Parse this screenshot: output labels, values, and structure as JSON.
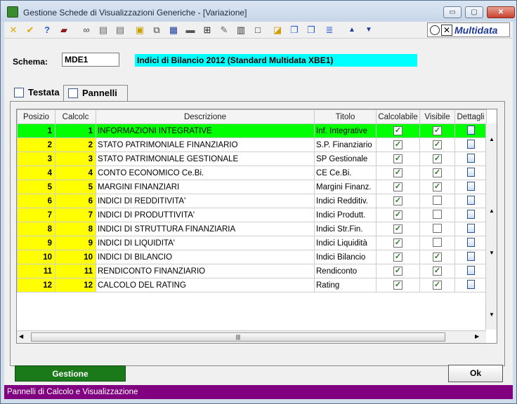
{
  "window": {
    "title": "Gestione Schede di Visualizzazioni Generiche - [Variazione]",
    "min": "▭",
    "max": "▢",
    "close": "✕"
  },
  "toolbar": {
    "icons": [
      "cancel-icon",
      "confirm-icon",
      "help-icon",
      "book-icon",
      "binoculars-icon",
      "doc-icon",
      "doc-icon",
      "tag-icon",
      "copy-icon",
      "print-icon",
      "screen-icon",
      "grid-icon",
      "edit-icon",
      "preview-icon",
      "page-icon",
      "chart-icon",
      "window-icon",
      "panel-icon",
      "form-icon",
      "arrow-up-icon",
      "arrow-down-icon"
    ],
    "brand": "Multidata"
  },
  "form": {
    "schema_label": "Schema:",
    "schema_code": "MDE1",
    "schema_desc": "Indici di Bilancio 2012 (Standard Multidata XBE1)"
  },
  "tabs": [
    {
      "label": "Testata"
    },
    {
      "label": "Pannelli"
    }
  ],
  "grid": {
    "columns": [
      "Posizio",
      "Calcolc",
      "Descrizione",
      "Titolo",
      "Calcolabile",
      "Visibile",
      "Dettagli"
    ],
    "rows": [
      {
        "pos": "1",
        "calc": "1",
        "desc": "INFORMAZIONI INTEGRATIVE",
        "title": "Inf. Integrative",
        "calcolabile": true,
        "visibile": true,
        "selected": true
      },
      {
        "pos": "2",
        "calc": "2",
        "desc": "STATO PATRIMONIALE FINANZIARIO",
        "title": "S.P. Finanziario",
        "calcolabile": true,
        "visibile": true
      },
      {
        "pos": "3",
        "calc": "3",
        "desc": "STATO PATRIMONIALE GESTIONALE",
        "title": "SP Gestionale",
        "calcolabile": true,
        "visibile": true
      },
      {
        "pos": "4",
        "calc": "4",
        "desc": "CONTO ECONOMICO Ce.Bi.",
        "title": "CE Ce.Bi.",
        "calcolabile": true,
        "visibile": true
      },
      {
        "pos": "5",
        "calc": "5",
        "desc": "MARGINI FINANZIARI",
        "title": "Margini Finanz.",
        "calcolabile": true,
        "visibile": true
      },
      {
        "pos": "6",
        "calc": "6",
        "desc": "INDICI DI REDDITIVITA'",
        "title": "Indici Redditiv.",
        "calcolabile": true,
        "visibile": false
      },
      {
        "pos": "7",
        "calc": "7",
        "desc": "INDICI DI PRODUTTIVITA'",
        "title": "Indici Produtt.",
        "calcolabile": true,
        "visibile": false
      },
      {
        "pos": "8",
        "calc": "8",
        "desc": "INDICI DI STRUTTURA FINANZIARIA",
        "title": "Indici Str.Fin.",
        "calcolabile": true,
        "visibile": false
      },
      {
        "pos": "9",
        "calc": "9",
        "desc": "INDICI DI LIQUIDITA'",
        "title": "Indici Liquidità",
        "calcolabile": true,
        "visibile": false
      },
      {
        "pos": "10",
        "calc": "10",
        "desc": "INDICI DI BILANCIO",
        "title": "Indici Bilancio",
        "calcolabile": true,
        "visibile": true
      },
      {
        "pos": "11",
        "calc": "11",
        "desc": "RENDICONTO FINANZIARIO",
        "title": "Rendiconto",
        "calcolabile": true,
        "visibile": true
      },
      {
        "pos": "12",
        "calc": "12",
        "desc": "CALCOLO DEL RATING",
        "title": "Rating",
        "calcolabile": true,
        "visibile": true
      }
    ]
  },
  "colors": {
    "row_num_bg": "#ffff00",
    "selected_row_bg": "#00ff00",
    "status_bg": "#800080"
  },
  "buttons": {
    "gestione": "Gestione",
    "ok": "Ok"
  },
  "status": "Pannelli di Calcolo e Visualizzazione"
}
